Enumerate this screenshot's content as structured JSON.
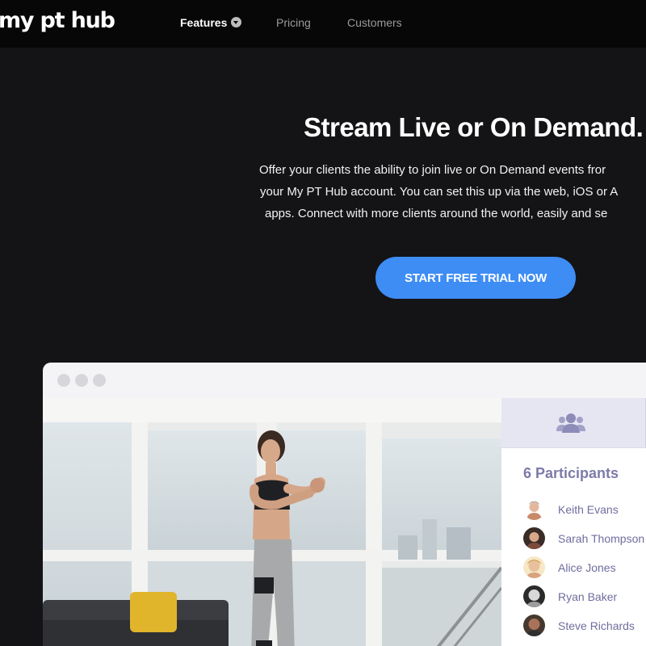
{
  "nav": {
    "logo": "my pt hub",
    "links": [
      {
        "label": "Features",
        "active": true,
        "has_dropdown": true
      },
      {
        "label": "Pricing",
        "active": false
      },
      {
        "label": "Customers",
        "active": false
      }
    ]
  },
  "hero": {
    "title": "Stream Live or On Demand.",
    "description_lines": [
      "Offer your clients the ability to join live or On Demand events fror",
      "your My PT Hub account. You can set this up via the web, iOS or A",
      "apps. Connect with more clients around the world, easily and se"
    ],
    "cta_label": "START FREE TRIAL NOW"
  },
  "app_window": {
    "panel": {
      "tab_icon": "participants-group-icon",
      "participants_title": "6 Participants",
      "participants": [
        {
          "name": "Keith Evans"
        },
        {
          "name": "Sarah Thompson"
        },
        {
          "name": "Alice Jones"
        },
        {
          "name": "Ryan Baker"
        },
        {
          "name": "Steve Richards"
        }
      ]
    }
  },
  "colors": {
    "background": "#141416",
    "nav_background": "#070707",
    "cta": "#3e8df5",
    "panel_accent": "#7d7ba8"
  }
}
